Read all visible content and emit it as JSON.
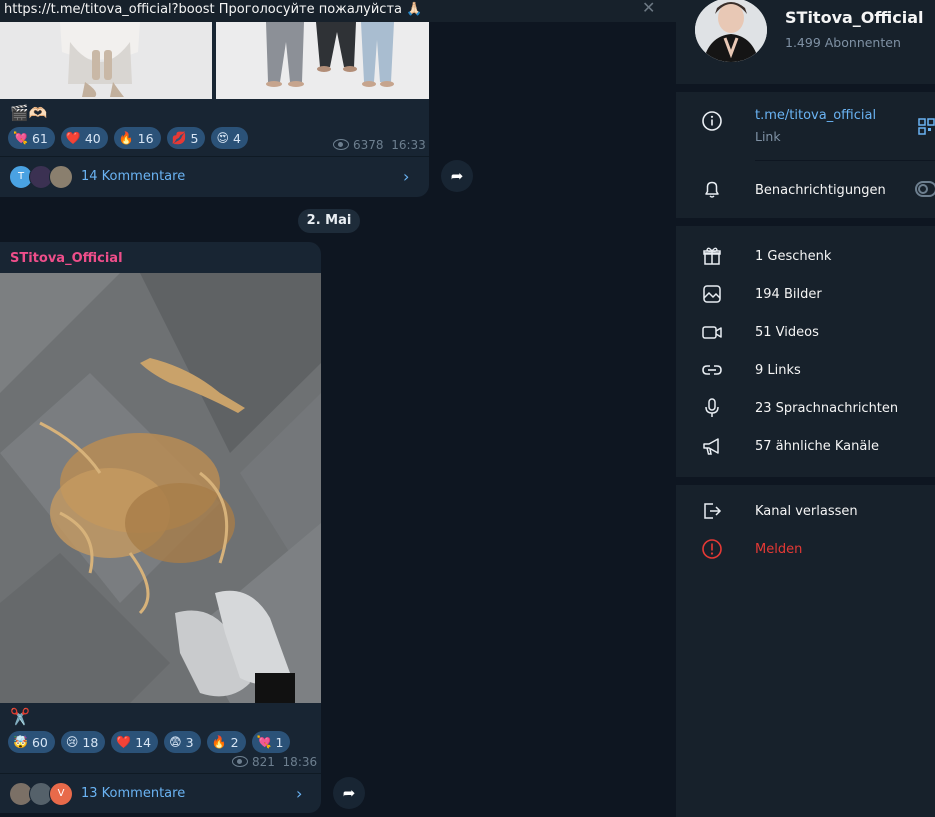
{
  "pinned": {
    "text": "https://t.me/titova_official?boost Проголосуйте пожалуйста 🙏🏻",
    "close_glyph": "✕"
  },
  "post1": {
    "caption": "🎬🫶🏻",
    "reactions": [
      {
        "emoji": "💘",
        "count": "61"
      },
      {
        "emoji": "❤️",
        "count": "40"
      },
      {
        "emoji": "🔥",
        "count": "16"
      },
      {
        "emoji": "💋",
        "count": "5"
      },
      {
        "emoji": "😍",
        "count": "4"
      }
    ],
    "views": "6378",
    "time": "16:33",
    "comments_label": "14 Kommentare",
    "avatar_initial": "T"
  },
  "date_separator": "2. Mai",
  "post2": {
    "author": "STitova_Official",
    "caption": "✂️",
    "reactions": [
      {
        "emoji": "🤯",
        "count": "60"
      },
      {
        "emoji": "😢",
        "count": "18"
      },
      {
        "emoji": "❤️",
        "count": "14"
      },
      {
        "emoji": "😨",
        "count": "3"
      },
      {
        "emoji": "🔥",
        "count": "2"
      },
      {
        "emoji": "💘",
        "count": "1"
      }
    ],
    "views": "821",
    "time": "18:36",
    "comments_label": "13 Kommentare",
    "avatar_initial": "V"
  },
  "channel": {
    "name": "STitova_Official",
    "subscribers": "1.499 Abonnenten",
    "link": "t.me/titova_official",
    "link_caption": "Link",
    "notifications_label": "Benachrichtigungen"
  },
  "media": [
    {
      "label": "1 Geschenk",
      "icon": "gift-icon"
    },
    {
      "label": "194 Bilder",
      "icon": "photo-icon"
    },
    {
      "label": "51 Videos",
      "icon": "video-icon"
    },
    {
      "label": "9 Links",
      "icon": "link-icon"
    },
    {
      "label": "23 Sprachnachrichten",
      "icon": "microphone-icon"
    },
    {
      "label": "57 ähnliche Kanäle",
      "icon": "megaphone-icon"
    }
  ],
  "actions": {
    "leave": "Kanal verlassen",
    "report": "Melden",
    "report_color": "#e53935"
  },
  "colors": {
    "accent": "#6ab3f3",
    "author": "#ee4e8a",
    "reaction_bg": "#2b5278"
  }
}
